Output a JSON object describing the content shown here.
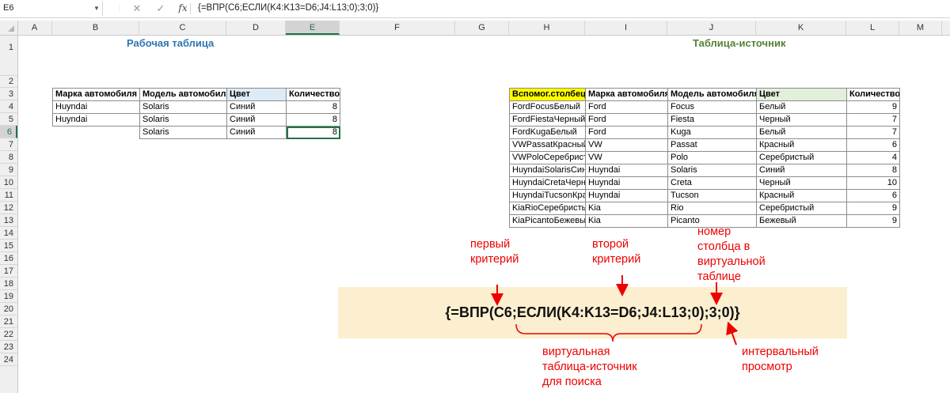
{
  "formula_bar": {
    "name_box": "E6",
    "cancel_icon": "✕",
    "enter_icon": "✓",
    "fx_label": "fx",
    "formula": "{=ВПР(C6;ЕСЛИ(K4:K13=D6;J4:L13;0);3;0)}"
  },
  "columns": [
    "A",
    "B",
    "C",
    "D",
    "E",
    "F",
    "G",
    "H",
    "I",
    "J",
    "K",
    "L",
    "M"
  ],
  "selected_column": "E",
  "rows": [
    "1",
    "2",
    "3",
    "4",
    "5",
    "6",
    "7",
    "8",
    "9",
    "10",
    "11",
    "12",
    "13",
    "14",
    "15",
    "16",
    "17",
    "18",
    "19",
    "20",
    "21",
    "22",
    "23",
    "24"
  ],
  "selected_row": "6",
  "work_table": {
    "title": "Рабочая таблица",
    "headers": [
      "Марка автомобиля",
      "Модель автомобиля",
      "Цвет",
      "Количество"
    ],
    "rows": [
      [
        "Huyndai",
        "Solaris",
        "Синий",
        "8"
      ],
      [
        "Huyndai",
        "Solaris",
        "Синий",
        "8"
      ],
      [
        "",
        "Solaris",
        "Синий",
        "8"
      ]
    ]
  },
  "source_table": {
    "title": "Таблица-источник",
    "headers": [
      "Вспомог.столбец",
      "Марка автомобиля",
      "Модель автомобиля",
      "Цвет",
      "Количество"
    ],
    "rows": [
      [
        "FordFocusБелый",
        "Ford",
        "Focus",
        "Белый",
        "9"
      ],
      [
        "FordFiestaЧерный",
        "Ford",
        "Fiesta",
        "Черный",
        "7"
      ],
      [
        "FordKugaБелый",
        "Ford",
        "Kuga",
        "Белый",
        "7"
      ],
      [
        "VWPassatКрасный",
        "VW",
        "Passat",
        "Красный",
        "6"
      ],
      [
        "VWPoloСеребрист",
        "VW",
        "Polo",
        "Серебристый",
        "4"
      ],
      [
        "HuyndaiSolarisСини",
        "Huyndai",
        "Solaris",
        "Синий",
        "8"
      ],
      [
        "HuyndaiCretaЧерны",
        "Huyndai",
        "Creta",
        "Черный",
        "10"
      ],
      [
        "HuyndaiTucsonКрас",
        "Huyndai",
        "Tucson",
        "Красный",
        "6"
      ],
      [
        "KiaRioСеребристы",
        "Kia",
        "Rio",
        "Серебристый",
        "9"
      ],
      [
        "KiaPicantoБежевый",
        "Kia",
        "Picanto",
        "Бежевый",
        "9"
      ]
    ]
  },
  "annotation": {
    "formula": "{=ВПР(C6;ЕСЛИ(K4:K13=D6;J4:L13;0);3;0)}",
    "first_criterion": [
      "первый",
      "критерий"
    ],
    "second_criterion": [
      "второй",
      "критерий"
    ],
    "column_number": [
      "номер",
      "столбца в",
      "виртуальной",
      "таблице"
    ],
    "interval_lookup": [
      "интервальный",
      "просмотр"
    ],
    "virtual_table": [
      "виртуальная",
      "таблица-источник",
      "для поиска"
    ]
  },
  "colors": {
    "title_blue": "#2e75b6",
    "title_green": "#548235",
    "header_yellow": "#ffff00",
    "header_blue": "#ddebf7",
    "header_green": "#e2efda",
    "selection_green": "#217346",
    "formula_box": "#fcefcf",
    "annotation_red": "#ee0000"
  }
}
